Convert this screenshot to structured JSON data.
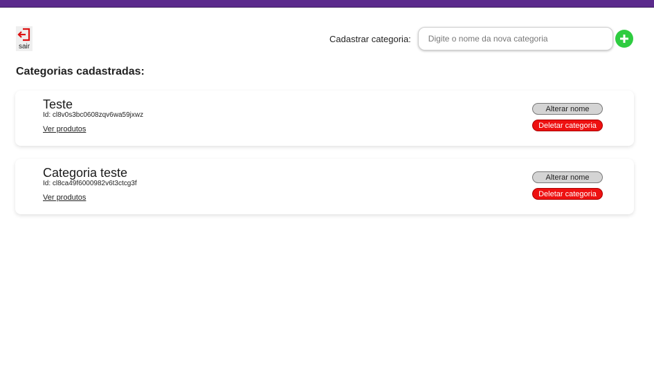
{
  "header": {
    "logout_label": "sair",
    "logout_icon": "logout-icon",
    "accent_color": "#5b2a8c"
  },
  "register": {
    "label": "Cadastrar categoria:",
    "placeholder": "Digite o nome da nova categoria",
    "value": "",
    "add_icon": "plus-icon",
    "add_color": "#2ecc40"
  },
  "section_title": "Categorias cadastradas:",
  "categories": [
    {
      "name": "Teste",
      "id_text": "Id: cl8v0s3bc0608zqv6wa59jxwz",
      "link_label": "Ver produtos",
      "rename_label": "Alterar nome",
      "delete_label": "Deletar categoria"
    },
    {
      "name": "Categoria teste",
      "id_text": "Id: cl8ca49f6000982v6t3ctcg3f",
      "link_label": "Ver produtos",
      "rename_label": "Alterar nome",
      "delete_label": "Deletar categoria"
    }
  ],
  "colors": {
    "delete": "#ee1111",
    "rename": "#d4d4d4"
  }
}
